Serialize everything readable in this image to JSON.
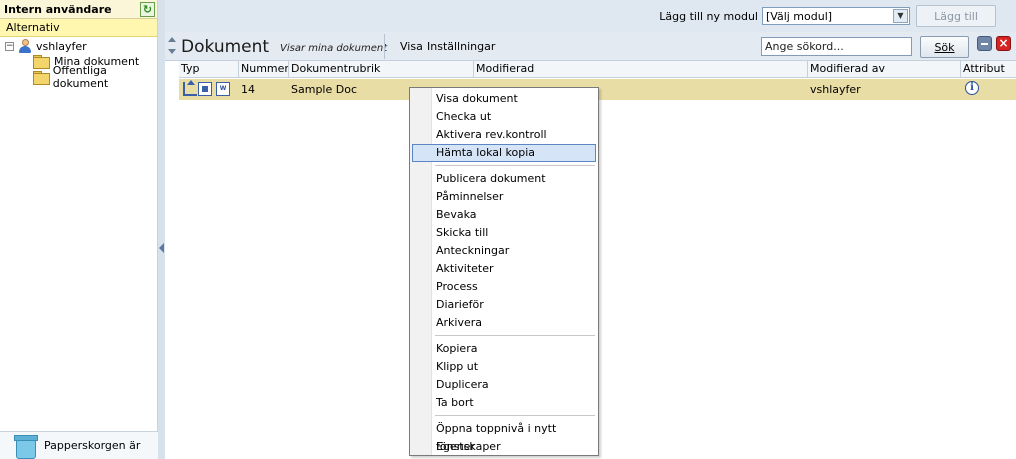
{
  "sidebar": {
    "title": "Intern användare",
    "alternative": "Alternativ",
    "tree": {
      "user": "vshlayfer",
      "items": [
        "Mina dokument",
        "Offentliga dokument"
      ]
    },
    "trash_label": "Papperskorgen är"
  },
  "topbar": {
    "add_module_label": "Lägg till ny modul",
    "module_select_value": "[Välj modul]",
    "add_button": "Lägg till"
  },
  "toolbar": {
    "title": "Dokument",
    "subtitle": "Visar mina dokument",
    "menu_visa": "Visa",
    "menu_settings": "Inställningar",
    "search_placeholder": "Ange sökord...",
    "search_button": "Sök"
  },
  "grid": {
    "columns": [
      "Typ",
      "Nummer",
      "Dokumentrubrik",
      "Modifierad",
      "Modifierad av",
      "Attribut"
    ],
    "rows": [
      {
        "number": "14",
        "title": "Sample Doc",
        "modified_by": "vshlayfer",
        "type_doc_label": "W"
      }
    ]
  },
  "context_menu": {
    "groups": [
      [
        "Visa dokument",
        "Checka ut",
        "Aktivera rev.kontroll",
        "Hämta lokal kopia"
      ],
      [
        "Publicera dokument",
        "Påminnelser",
        "Bevaka",
        "Skicka till",
        "Anteckningar",
        "Aktiviteter",
        "Process",
        "Diarieför",
        "Arkivera"
      ],
      [
        "Kopiera",
        "Klipp ut",
        "Duplicera",
        "Ta bort"
      ],
      [
        "Öppna toppnivå i nytt fönster",
        "Egenskaper"
      ]
    ],
    "highlighted": "Hämta lokal kopia"
  },
  "colors": {
    "row_selected": "#e9dda6",
    "menu_highlight": "#d6e4f7",
    "panel_header": "#fbf6d8",
    "toolbar_bg": "#e4eaf1"
  },
  "icons": {
    "refresh": "refresh-icon",
    "user": "user-icon",
    "folder": "folder-icon",
    "trash": "trash-icon",
    "info": "info-icon"
  }
}
